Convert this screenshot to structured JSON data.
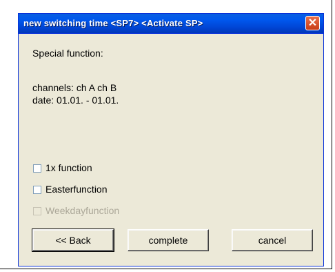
{
  "window": {
    "title": "new switching time <SP7> <Activate SP>",
    "close_label": "✕"
  },
  "content": {
    "heading": "Special function:",
    "channels": "channels: ch A ch B",
    "date": "date: 01.01. - 01.01."
  },
  "checkboxes": [
    {
      "label": "1x function",
      "checked": false,
      "enabled": true
    },
    {
      "label": "Easterfunction",
      "checked": false,
      "enabled": true
    },
    {
      "label": "Weekdayfunction",
      "checked": false,
      "enabled": false
    }
  ],
  "buttons": {
    "back": "<< Back",
    "complete": "complete",
    "cancel": "cancel"
  }
}
